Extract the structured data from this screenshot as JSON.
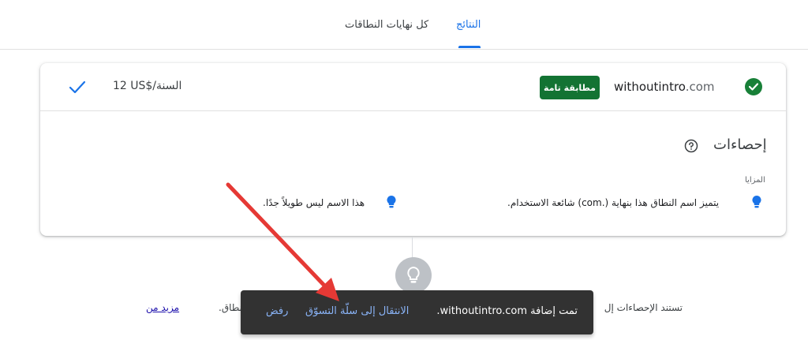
{
  "tabs": {
    "results": "النتائج",
    "all_extensions": "كل نهايات النطاقات"
  },
  "result": {
    "domain_name": "withoutintro",
    "domain_tld": ".com",
    "match_badge": "مطابقة تامة",
    "price": "12 US$/السنة"
  },
  "stats": {
    "title": "إحصاءات",
    "advantages_label": "المزايا",
    "advantage_1": "يتميز اسم النطاق هذا بنهاية (.com) شائعة الاستخدام.",
    "advantage_2": "هذا الاسم ليس طويلاً جدًا."
  },
  "footnote": {
    "start": "تستند الإحصاءات إل",
    "end": "بطة بالنطاق.",
    "learn_more": "مزيد من"
  },
  "snackbar": {
    "message": "تمت إضافة withoutintro.com.",
    "go_to_cart": "الانتقال إلى سلّة التسوّق",
    "dismiss": "رفض"
  },
  "colors": {
    "accent": "#1a73e8",
    "match_green": "#137333",
    "check_green": "#188038",
    "snackbar_bg": "#323232",
    "snackbar_link": "#8ab4f8",
    "annotation_arrow": "#e53935"
  },
  "icons": [
    "check-circle-icon",
    "checkmark-icon",
    "help-icon",
    "lightbulb-icon",
    "lightbulb-icon",
    "lightbulb-large-icon"
  ]
}
